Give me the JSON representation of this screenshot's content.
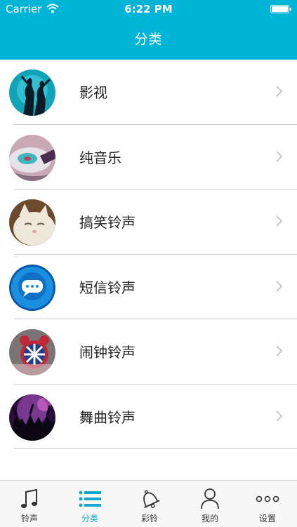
{
  "status": {
    "carrier": "Carrier",
    "time": "6:22 PM"
  },
  "nav": {
    "title": "分类"
  },
  "categories": [
    {
      "label": "影视",
      "icon": "movie-avatar"
    },
    {
      "label": "纯音乐",
      "icon": "pure-music-avatar"
    },
    {
      "label": "搞笑铃声",
      "icon": "funny-cat-avatar"
    },
    {
      "label": "短信铃声",
      "icon": "sms-bubble-avatar"
    },
    {
      "label": "闹钟铃声",
      "icon": "alarm-clock-avatar"
    },
    {
      "label": "舞曲铃声",
      "icon": "dance-crowd-avatar"
    }
  ],
  "tabs": [
    {
      "label": "铃声",
      "icon": "music-note-icon",
      "active": false
    },
    {
      "label": "分类",
      "icon": "list-icon",
      "active": true
    },
    {
      "label": "彩铃",
      "icon": "bell-icon",
      "active": false
    },
    {
      "label": "我的",
      "icon": "person-icon",
      "active": false
    },
    {
      "label": "设置",
      "icon": "more-dots-icon",
      "active": false
    }
  ],
  "colors": {
    "nav_bar": "#00b4d8",
    "tab_active": "#13a7cf",
    "tab_inactive": "#333333"
  }
}
